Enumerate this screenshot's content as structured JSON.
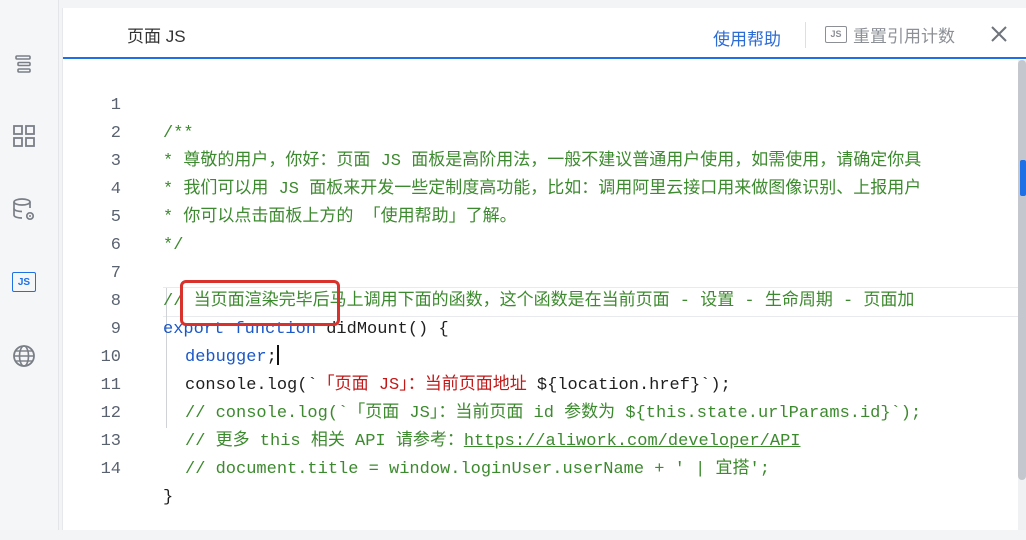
{
  "rail": {
    "items": [
      {
        "icon": "outline-tree-icon"
      },
      {
        "icon": "component-grid-icon"
      },
      {
        "icon": "datasource-settings-icon"
      },
      {
        "icon": "js-icon",
        "label": "JS"
      },
      {
        "icon": "globe-icon"
      }
    ],
    "active_color": "#1f6fe5"
  },
  "panel": {
    "title": "页面 JS",
    "help_label": "使用帮助",
    "reset_badge": "JS",
    "reset_label": "重置引用计数",
    "close_icon": "close-icon"
  },
  "editor": {
    "line_numbers": [
      "1",
      "2",
      "3",
      "4",
      "5",
      "6",
      "7",
      "8",
      "9",
      "10",
      "11",
      "12",
      "13",
      "14"
    ],
    "lines": {
      "l1": "/**",
      "l2": "* 尊敬的用户，你好：页面 JS 面板是高阶用法，一般不建议普通用户使用，如需使用，请确定你具",
      "l3": "* 我们可以用 JS 面板来开发一些定制度高功能，比如：调用阿里云接口用来做图像识别、上报用户",
      "l4": "* 你可以点击面板上方的 「使用帮助」了解。",
      "l5": "*/",
      "l6": "",
      "l7": "// 当页面渲染完毕后马上调用下面的函数，这个函数是在当前页面 - 设置 - 生命周期 - 页面加",
      "l8_kw": "export function",
      "l8_rest": " didMount() {",
      "l9_kw": "debugger",
      "l9_rest": ";",
      "l10_a": "console.log(`",
      "l10_str": "「页面 JS」：当前页面地址",
      "l10_b": " ${location.href}`);",
      "l11": "// console.log(`「页面 JS」：当前页面 id 参数为 ${this.state.urlParams.id}`);",
      "l12_a": "// 更多 this 相关 API 请参考：",
      "l12_link": "https://aliwork.com/developer/API",
      "l13": "// document.title = window.loginUser.userName + ' | 宜搭';",
      "l14": "}"
    }
  },
  "colors": {
    "accent": "#1f6fe5",
    "comment": "#3c8a2e",
    "keyword": "#1a57c9",
    "string": "#c21818",
    "annotation": "#d9312b"
  }
}
